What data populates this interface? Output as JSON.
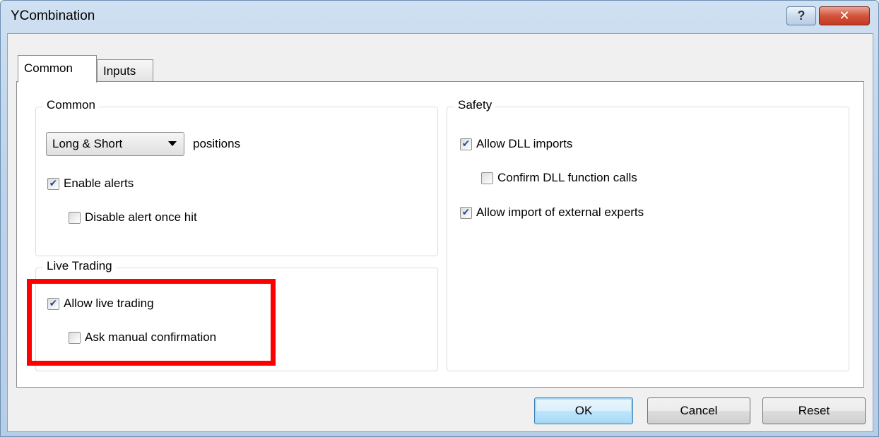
{
  "window": {
    "title": "YCombination",
    "help_label": "?",
    "close_label": "✕"
  },
  "tabs": [
    {
      "label": "Common",
      "active": true
    },
    {
      "label": "Inputs",
      "active": false
    }
  ],
  "common_group": {
    "legend": "Common",
    "position_select": {
      "value": "Long & Short"
    },
    "positions_suffix": "positions",
    "enable_alerts": {
      "label": "Enable alerts",
      "checked": true
    },
    "disable_alert_once_hit": {
      "label": "Disable alert once hit",
      "checked": false
    }
  },
  "live_trading_group": {
    "legend": "Live Trading",
    "allow_live_trading": {
      "label": "Allow live trading",
      "checked": true
    },
    "ask_manual_confirmation": {
      "label": "Ask manual confirmation",
      "checked": false
    }
  },
  "safety_group": {
    "legend": "Safety",
    "allow_dll_imports": {
      "label": "Allow DLL imports",
      "checked": true
    },
    "confirm_dll_calls": {
      "label": "Confirm DLL function calls",
      "checked": false
    },
    "allow_external_experts": {
      "label": "Allow import of external experts",
      "checked": true
    }
  },
  "buttons": {
    "ok": "OK",
    "cancel": "Cancel",
    "reset": "Reset"
  },
  "colors": {
    "highlight": "#ff0000",
    "check_mark": "#2a4d9c"
  }
}
